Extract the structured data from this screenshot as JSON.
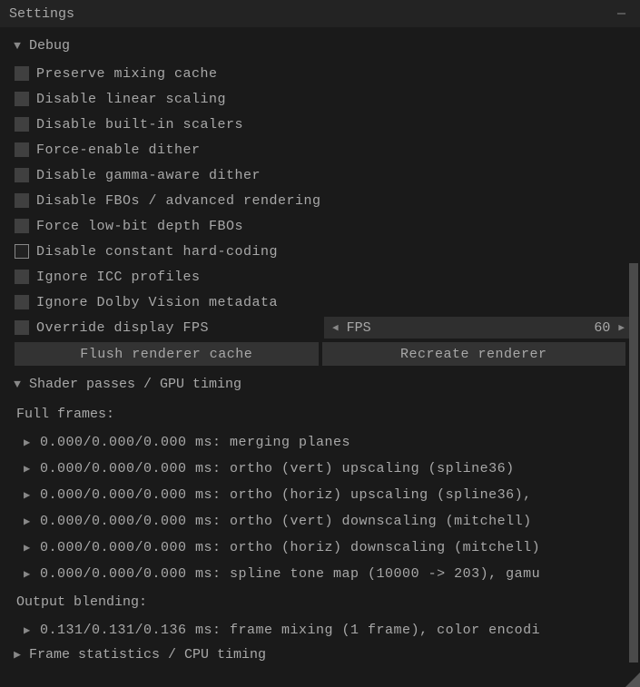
{
  "window": {
    "title": "Settings",
    "minimize": "—"
  },
  "sections": {
    "debug": {
      "label": "Debug",
      "checkboxes": [
        {
          "label": "Preserve mixing cache",
          "checked": false
        },
        {
          "label": "Disable linear scaling",
          "checked": false
        },
        {
          "label": "Disable built-in scalers",
          "checked": false
        },
        {
          "label": "Force-enable dither",
          "checked": false
        },
        {
          "label": "Disable gamma-aware dither",
          "checked": false
        },
        {
          "label": "Disable FBOs / advanced rendering",
          "checked": false
        },
        {
          "label": "Force low-bit depth FBOs",
          "checked": false
        },
        {
          "label": "Disable constant hard-coding",
          "checked": true
        },
        {
          "label": "Ignore ICC profiles",
          "checked": false
        },
        {
          "label": "Ignore Dolby Vision metadata",
          "checked": false
        }
      ],
      "fps": {
        "checkbox_label": "Override display FPS",
        "label": "FPS",
        "value": "60"
      },
      "buttons": {
        "flush": "Flush renderer cache",
        "recreate": "Recreate renderer"
      }
    },
    "shader": {
      "label": "Shader passes / GPU timing",
      "full_frames_label": "Full frames:",
      "full_frames": [
        "0.000/0.000/0.000 ms: merging planes",
        "0.000/0.000/0.000 ms: ortho (vert) upscaling (spline36)",
        "0.000/0.000/0.000 ms: ortho (horiz) upscaling (spline36),",
        "0.000/0.000/0.000 ms: ortho (vert) downscaling (mitchell)",
        "0.000/0.000/0.000 ms: ortho (horiz) downscaling (mitchell)",
        "0.000/0.000/0.000 ms: spline tone map (10000 -> 203), gamu"
      ],
      "output_blending_label": "Output blending:",
      "output_blending": [
        "0.131/0.131/0.136 ms: frame mixing (1 frame), color encodi"
      ]
    },
    "frame_stats": {
      "label": "Frame statistics / CPU timing"
    }
  }
}
